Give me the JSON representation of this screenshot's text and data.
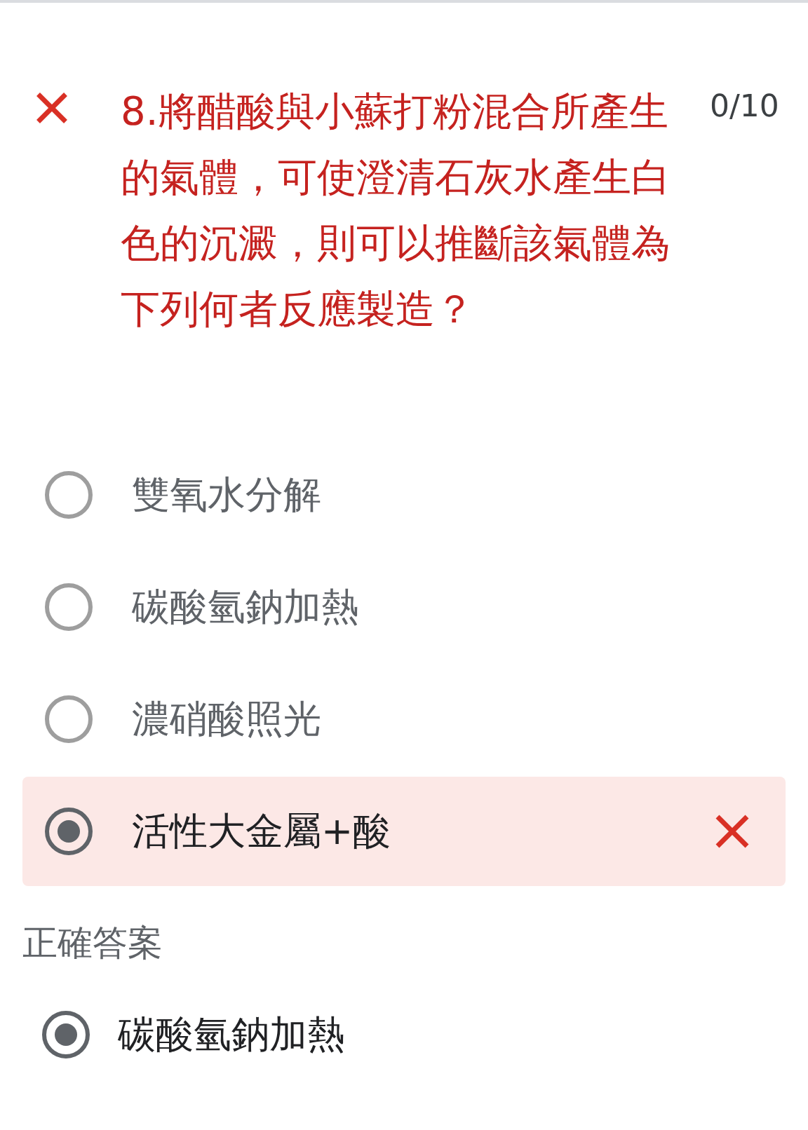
{
  "question": {
    "correct": false,
    "text": "8.將醋酸與小蘇打粉混合所產生的氣體，可使澄清石灰水產生白色的沉澱，則可以推斷該氣體為下列何者反應製造？",
    "score": "0/10"
  },
  "options": [
    {
      "label": "雙氧水分解",
      "selected": false,
      "wrong": false
    },
    {
      "label": "碳酸氫鈉加熱",
      "selected": false,
      "wrong": false
    },
    {
      "label": "濃硝酸照光",
      "selected": false,
      "wrong": false
    },
    {
      "label": "活性大金屬+酸",
      "selected": true,
      "wrong": true
    }
  ],
  "correct_answer": {
    "heading": "正確答案",
    "options": [
      {
        "label": "碳酸氫鈉加熱",
        "selected": true
      }
    ]
  }
}
